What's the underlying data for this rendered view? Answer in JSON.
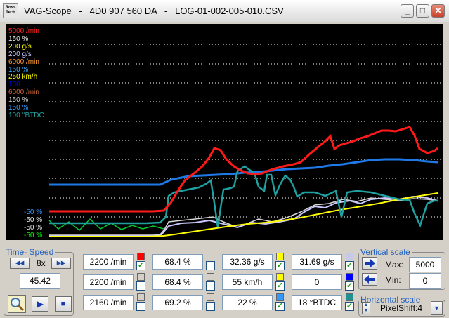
{
  "window": {
    "logo_text": "Ross Tech",
    "title": "VAG-Scope   -   4D0 907 560 DA   -   LOG-01-002-005-010.CSV",
    "minimize_glyph": "_",
    "maximize_glyph": "□",
    "close_glyph": "✕"
  },
  "chart": {
    "top_labels": [
      {
        "text": "5000 /min",
        "color": "#ff2020"
      },
      {
        "text": "150 %",
        "color": "#e6e6e6"
      },
      {
        "text": "200 g/s",
        "color": "#ffff00"
      },
      {
        "text": "200 g/s",
        "color": "#c8c8ff"
      },
      {
        "text": "6000 /min",
        "color": "#ff9933"
      },
      {
        "text": "150 %",
        "color": "#33aaff"
      },
      {
        "text": "250 km/h",
        "color": "#ffff00"
      },
      {
        "text": "100",
        "color": "#0000ff"
      },
      {
        "text": "6000 /min",
        "color": "#cc6633"
      },
      {
        "text": "150 %",
        "color": "#cccccc"
      },
      {
        "text": "150 %",
        "color": "#3399ff"
      },
      {
        "text": "100 °BTDC",
        "color": "#20a0a0"
      }
    ],
    "bottom_labels": [
      {
        "text": "-50 %",
        "color": "#3399ff"
      },
      {
        "text": "-50 %",
        "color": "#e6e6e6"
      },
      {
        "text": "-50 %",
        "color": "#e6e6e6"
      },
      {
        "text": "-50 %",
        "color": "#00ff00"
      }
    ]
  },
  "time_speed": {
    "legend": "Time- Speed",
    "rewind_glyph": "◀◀",
    "speed": "8x",
    "forward_glyph": "▶▶",
    "time_value": "45.42",
    "zoom_icon": "magnifier-icon",
    "play_glyph": "▶",
    "stop_glyph": "■"
  },
  "channels": [
    {
      "value": "2200 /min",
      "color": "#ff0000",
      "checked": true
    },
    {
      "value": "2200 /min",
      "color": "#d4d0c8",
      "checked": false
    },
    {
      "value": "2160 /min",
      "color": "#d4d0c8",
      "checked": false
    },
    {
      "value": "68.4 %",
      "color": "#d4d0c8",
      "checked": false
    },
    {
      "value": "68.4 %",
      "color": "#d4d0c8",
      "checked": false
    },
    {
      "value": "69.2 %",
      "color": "#d4d0c8",
      "checked": false
    },
    {
      "value": "32.36 g/s",
      "color": "#ffff00",
      "checked": true
    },
    {
      "value": "55 km/h",
      "color": "#ffff00",
      "checked": true
    },
    {
      "value": "22 %",
      "color": "#3399ff",
      "checked": true
    },
    {
      "value": "31.69 g/s",
      "color": "#c8c8e8",
      "checked": true
    },
    {
      "value": "0",
      "color": "#0000ff",
      "checked": true
    },
    {
      "value": "18 °BTDC",
      "color": "#209090",
      "checked": true
    }
  ],
  "vertical_scale": {
    "legend": "Vertical scale",
    "max_label": "Max:",
    "max_value": "5000",
    "min_label": "Min:",
    "min_value": "0"
  },
  "horizontal_scale": {
    "legend": "Horizontal scale",
    "value": "PixelShift:4"
  }
}
